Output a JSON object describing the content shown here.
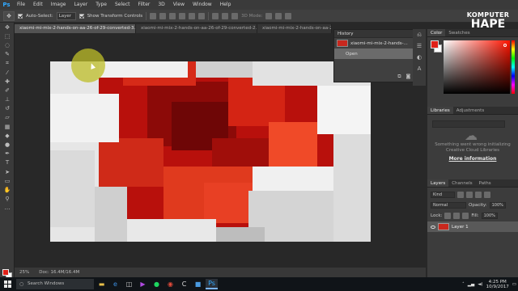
{
  "app": {
    "logo": "Ps"
  },
  "menu": [
    "File",
    "Edit",
    "Image",
    "Layer",
    "Type",
    "Select",
    "Filter",
    "3D",
    "View",
    "Window",
    "Help"
  ],
  "options_bar": {
    "auto_select_label": "Auto-Select:",
    "auto_select_value": "Layer",
    "show_transform_label": "Show Transform Controls",
    "mode_3d_label": "3D Mode:"
  },
  "tabs": [
    {
      "label": "xiaomi-mi-mix-2-hands-on-aa-26-of-29-converted-3.pdf @ 25% (Layer 1, RGB/8) *",
      "active": true
    },
    {
      "label": "xiaomi-mi-mix-2-hands-on-aa-26-of-29-converted-2.pdf",
      "active": false
    },
    {
      "label": "xiaomi-mi-mix-2-hands-on-aa-26-of-29-converted-1.pdf",
      "active": false
    }
  ],
  "history": {
    "title": "History",
    "snapshot_label": "xiaomi-mi-mix-2-hands-...",
    "states": [
      "Open"
    ]
  },
  "color_panel": {
    "tabs": [
      "Color",
      "Swatches"
    ],
    "fg": "#e02018",
    "bg": "#ffffff"
  },
  "libraries": {
    "tabs": [
      "Libraries",
      "Adjustments"
    ],
    "message": "Something went wrong initializing Creative Cloud Libraries",
    "more_info": "More information"
  },
  "layers": {
    "tabs": [
      "Layers",
      "Channels",
      "Paths"
    ],
    "kind_label": "Kind",
    "blend_mode": "Normal",
    "opacity_label": "Opacity:",
    "opacity_value": "100%",
    "lock_label": "Lock:",
    "fill_label": "Fill:",
    "fill_value": "100%",
    "items": [
      {
        "name": "Layer 1",
        "visible": true
      }
    ]
  },
  "status": {
    "zoom": "25%",
    "doc": "Doc: 16.4M/16.4M"
  },
  "watermark": {
    "line1": "KOMPUTER",
    "line2": "HAPE"
  },
  "taskbar": {
    "search_placeholder": "Search Windows",
    "apps": [
      "file-explorer",
      "edge",
      "store",
      "media",
      "spotify",
      "chrome",
      "ccleaner",
      "video",
      "photoshop"
    ],
    "time": "4:25 PM",
    "date": "10/9/2017"
  }
}
